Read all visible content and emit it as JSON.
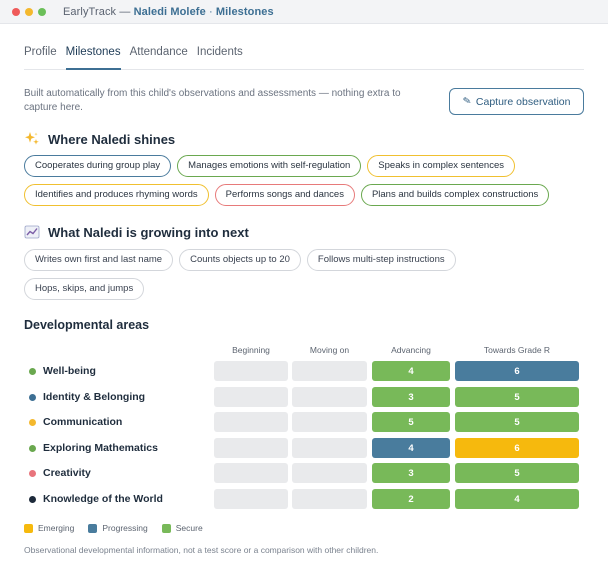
{
  "window": {
    "app_name": "EarlyTrack",
    "separator": "—",
    "child_name": "Naledi Molefe",
    "middot": "·",
    "section": "Milestones"
  },
  "tabs": [
    {
      "label": "Profile",
      "active": false
    },
    {
      "label": "Milestones",
      "active": true
    },
    {
      "label": "Attendance",
      "active": false
    },
    {
      "label": "Incidents",
      "active": false
    }
  ],
  "intro": "Built automatically from this child's observations and assessments — nothing extra to capture here.",
  "capture_button": {
    "label": "Capture observation",
    "icon": "pencil-icon"
  },
  "shines": {
    "title": "Where Naledi shines",
    "icon": "sparkles-icon",
    "chips": [
      {
        "label": "Cooperates during group play",
        "color": "blue"
      },
      {
        "label": "Manages emotions with self-regulation",
        "color": "green"
      },
      {
        "label": "Speaks in complex sentences",
        "color": "yellow"
      },
      {
        "label": "Identifies and produces rhyming words",
        "color": "yellow"
      },
      {
        "label": "Performs songs and dances",
        "color": "red"
      },
      {
        "label": "Plans and builds complex constructions",
        "color": "green"
      }
    ]
  },
  "growing": {
    "title": "What Naledi is growing into next",
    "icon": "chart-line-icon",
    "chips": [
      {
        "label": "Writes own first and last name"
      },
      {
        "label": "Counts objects up to 20"
      },
      {
        "label": "Follows multi-step instructions"
      },
      {
        "label": "Hops, skips, and jumps"
      }
    ]
  },
  "developmental": {
    "title": "Developmental areas",
    "columns": [
      "Beginning",
      "Moving on",
      "Advancing",
      "Towards Grade R"
    ],
    "rows": [
      {
        "label": "Well-being",
        "dot": "#6aa84f",
        "cells": [
          null,
          null,
          {
            "value": "4",
            "status": "secure"
          },
          {
            "value": "6",
            "status": "progressing"
          }
        ]
      },
      {
        "label": "Identity & Belonging",
        "dot": "#3d6f93",
        "cells": [
          null,
          null,
          {
            "value": "3",
            "status": "secure"
          },
          {
            "value": "5",
            "status": "secure"
          }
        ]
      },
      {
        "label": "Communication",
        "dot": "#f4b82e",
        "cells": [
          null,
          null,
          {
            "value": "5",
            "status": "secure"
          },
          {
            "value": "5",
            "status": "secure"
          }
        ]
      },
      {
        "label": "Exploring Mathematics",
        "dot": "#6aa84f",
        "cells": [
          null,
          null,
          {
            "value": "4",
            "status": "progressing"
          },
          {
            "value": "6",
            "status": "emerging"
          }
        ]
      },
      {
        "label": "Creativity",
        "dot": "#e8747c",
        "cells": [
          null,
          null,
          {
            "value": "3",
            "status": "secure"
          },
          {
            "value": "5",
            "status": "secure"
          }
        ]
      },
      {
        "label": "Knowledge of the World",
        "dot": "#1d2a3a",
        "cells": [
          null,
          null,
          {
            "value": "2",
            "status": "secure"
          },
          {
            "value": "4",
            "status": "secure"
          }
        ]
      }
    ]
  },
  "legend": [
    {
      "label": "Emerging",
      "color": "#f6b90d"
    },
    {
      "label": "Progressing",
      "color": "#497c9d"
    },
    {
      "label": "Secure",
      "color": "#78b959"
    }
  ],
  "footnote": "Observational developmental information, not a test score or a comparison with other children."
}
